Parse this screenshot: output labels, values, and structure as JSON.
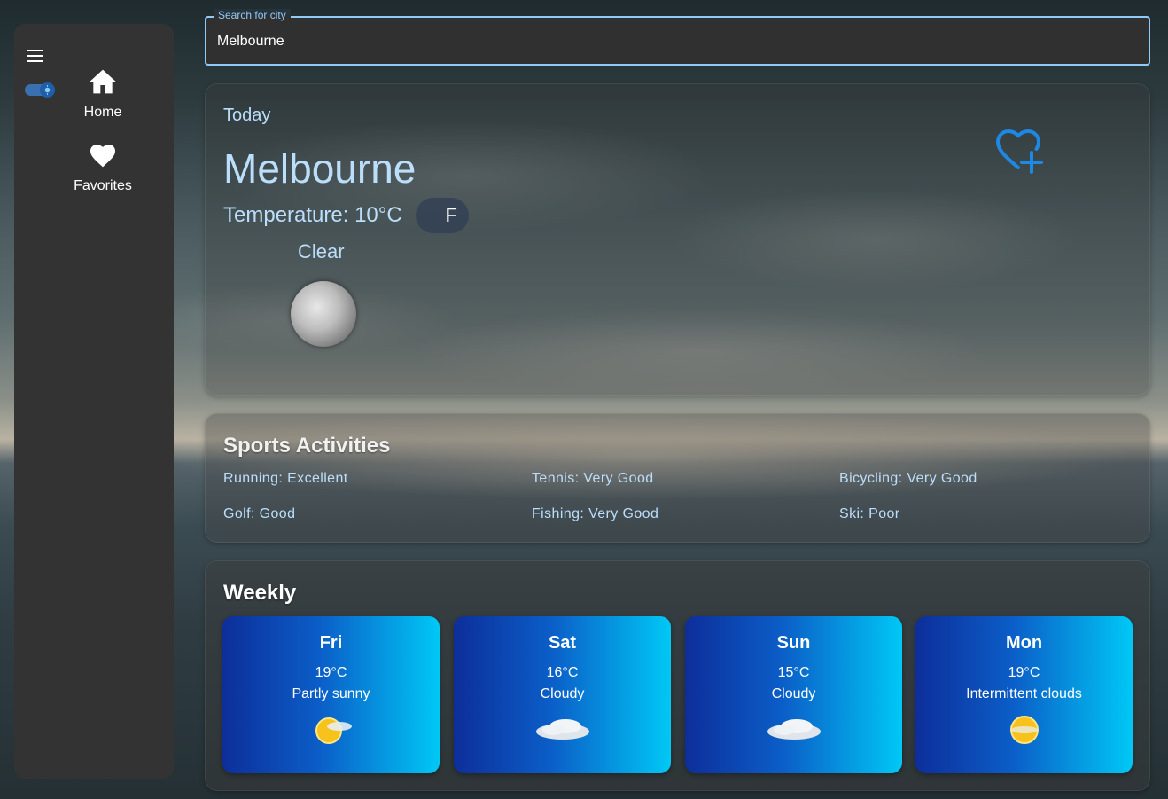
{
  "sidebar": {
    "nav": [
      {
        "label": "Home",
        "icon": "home-icon"
      },
      {
        "label": "Favorites",
        "icon": "heart-icon"
      }
    ]
  },
  "search": {
    "label": "Search for city",
    "value": "Melbourne"
  },
  "today": {
    "heading": "Today",
    "city": "Melbourne",
    "temperature": "Temperature: 10°C",
    "unit_toggle": "F",
    "condition": "Clear",
    "condition_icon": "moon-icon"
  },
  "sports": {
    "title": "Sports Activities",
    "items": [
      "Running: Excellent",
      "Tennis: Very Good",
      "Bicycling: Very Good",
      "Golf: Good",
      "Fishing: Very Good",
      "Ski: Poor"
    ]
  },
  "weekly": {
    "title": "Weekly",
    "days": [
      {
        "day": "Fri",
        "temp": "19°C",
        "condition": "Partly sunny",
        "icon": "partly-sunny-icon"
      },
      {
        "day": "Sat",
        "temp": "16°C",
        "condition": "Cloudy",
        "icon": "cloudy-icon"
      },
      {
        "day": "Sun",
        "temp": "15°C",
        "condition": "Cloudy",
        "icon": "cloudy-icon"
      },
      {
        "day": "Mon",
        "temp": "19°C",
        "condition": "Intermittent clouds",
        "icon": "intermittent-clouds-icon"
      }
    ]
  },
  "colors": {
    "accent": "#90caf9",
    "text_light_blue": "#bbdefb",
    "favorite_icon": "#1e88e5"
  }
}
